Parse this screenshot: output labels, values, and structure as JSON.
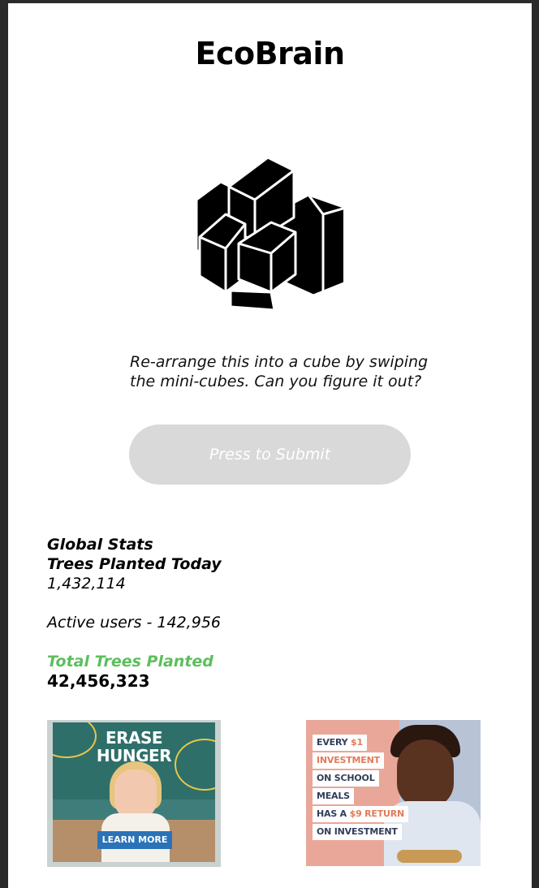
{
  "app": {
    "title": "EcoBrain"
  },
  "puzzle": {
    "icon": "stacked-cubes-icon",
    "instructions_line1": "Re-arrange this into a cube by swiping",
    "instructions_line2": "the mini-cubes. Can you figure it out?"
  },
  "submit": {
    "label": "Press to Submit"
  },
  "stats": {
    "heading": "Global Stats",
    "trees_today_label": "Trees Planted Today",
    "trees_today_value": "1,432,114",
    "active_users": "Active users - 142,956",
    "total_label": "Total Trees Planted",
    "total_value": "42,456,323"
  },
  "ads": {
    "ad1": {
      "headline_line1": "ERASE",
      "headline_line2": "HUNGER",
      "cta": "LEARN MORE"
    },
    "ad2": {
      "lines": [
        {
          "text": "EVERY ",
          "accent": "$1"
        },
        {
          "text": "",
          "accent": "INVESTMENT"
        },
        {
          "text": "ON SCHOOL",
          "accent": ""
        },
        {
          "text": "MEALS",
          "accent": ""
        },
        {
          "text": "HAS A ",
          "accent": "$9 RETURN"
        },
        {
          "text": "ON INVESTMENT",
          "accent": ""
        }
      ]
    }
  },
  "colors": {
    "accent_green": "#5cbf5c",
    "button_disabled": "#d9d9d9",
    "cta_blue": "#2b73b8",
    "ad_accent": "#e07a5a"
  }
}
